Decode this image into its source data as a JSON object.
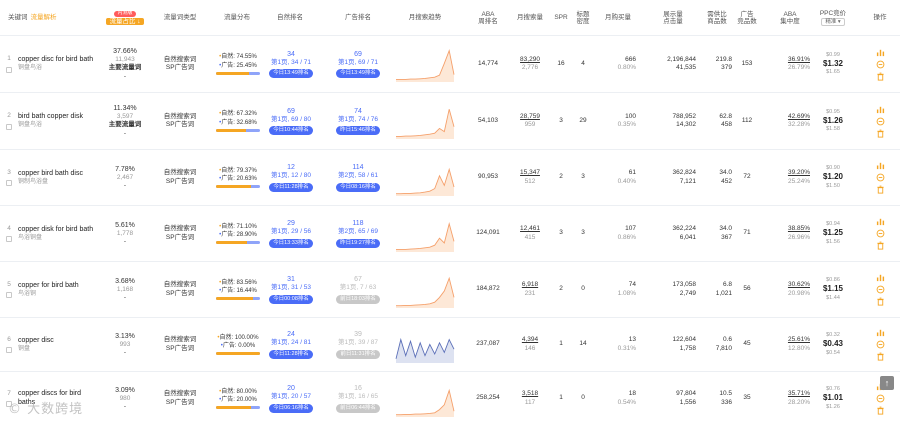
{
  "header": {
    "keyword": "关键词",
    "keyword_link": "流量解析",
    "ratio_badge": "内测版",
    "ratio": "流量占比 ↓",
    "type": "流量词类型",
    "dist": "流量分布",
    "organic_rank": "自然排名",
    "ad_rank": "广告排名",
    "trend": "月搜索趋势",
    "aba1": "ABA",
    "aba2": "周排名",
    "monthly": "月搜索量",
    "spr": "SPR",
    "title_density1": "标题",
    "title_density2": "密度",
    "purchase": "月购买量",
    "impr1": "展示量",
    "impr2": "点击量",
    "supply1": "需供比",
    "supply2": "商品数",
    "ad1": "广告",
    "ad2": "竞品数",
    "conc1": "ABA",
    "conc2": "集中度",
    "ppc": "PPC竞价",
    "ppc_sel": "精准 ▾",
    "ops": "操作"
  },
  "rows": [
    {
      "idx": "1",
      "kw": "copper disc for bird bath",
      "kw_cn": "铜盘鸟浴",
      "ratio": "37.66%",
      "ratio_sub": "11,943",
      "main": "主要流量词",
      "dash": "-",
      "type1": "自然搜索词",
      "type2": "SP广告词",
      "org_label": "自然:",
      "org_pct": "74.55%",
      "ad_label": "广告:",
      "ad_pct": "25.45%",
      "org_share": 0.7455,
      "or_main": "34",
      "or_sub": "第1页, 34 / 71",
      "or_pill": "今日13:49排名",
      "ad_main": "69",
      "ad_sub": "第1页, 69 / 71",
      "ad_pill": "今日13:49排名",
      "ad_grey": false,
      "trend": [
        0.05,
        0.05,
        0.05,
        0.06,
        0.06,
        0.07,
        0.08,
        0.1,
        0.12,
        0.18,
        0.55,
        0.95,
        0.2
      ],
      "aba": "14,774",
      "m1": "83,290",
      "m2": "2,776",
      "spr": "16",
      "td": "4",
      "p1": "666",
      "p2": "0.80%",
      "i1": "2,196,844",
      "i2": "41,535",
      "s1": "219.8",
      "s2": "379",
      "adc": "153",
      "c1": "36.91%",
      "c2": "26.79%",
      "pp1": "$0.99",
      "pp2": "$1.32",
      "pp3": "$1.65"
    },
    {
      "idx": "2",
      "kw": "bird bath copper disk",
      "kw_cn": "铜盘鸟浴",
      "ratio": "11.34%",
      "ratio_sub": "3,597",
      "main": "主要流量词",
      "dash": "-",
      "type1": "自然搜索词",
      "type2": "SP广告词",
      "org_label": "自然:",
      "org_pct": "67.32%",
      "ad_label": "广告:",
      "ad_pct": "32.68%",
      "org_share": 0.6732,
      "or_main": "69",
      "or_sub": "第1页, 69 / 80",
      "or_pill": "今日10:44排名",
      "ad_main": "74",
      "ad_sub": "第1页, 74 / 76",
      "ad_pill": "昨日15:46排名",
      "ad_grey": false,
      "trend": [
        0.05,
        0.05,
        0.06,
        0.06,
        0.07,
        0.08,
        0.1,
        0.12,
        0.15,
        0.3,
        0.2,
        0.9,
        0.35
      ],
      "aba": "54,103",
      "m1": "28,759",
      "m2": "959",
      "spr": "3",
      "td": "29",
      "p1": "100",
      "p2": "0.35%",
      "i1": "788,952",
      "i2": "14,302",
      "s1": "62.8",
      "s2": "458",
      "adc": "112",
      "c1": "42.69%",
      "c2": "32.28%",
      "pp1": "$0.95",
      "pp2": "$1.26",
      "pp3": "$1.58"
    },
    {
      "idx": "3",
      "kw": "copper bird bath disc",
      "kw_cn": "铜制鸟浴盘",
      "ratio": "7.78%",
      "ratio_sub": "2,467",
      "main": "",
      "dash": "-",
      "type1": "自然搜索词",
      "type2": "SP广告词",
      "org_label": "自然:",
      "org_pct": "79.37%",
      "ad_label": "广告:",
      "ad_pct": "20.63%",
      "org_share": 0.7937,
      "or_main": "12",
      "or_sub": "第1页, 12 / 80",
      "or_pill": "今日11:28排名",
      "ad_main": "114",
      "ad_sub": "第2页, 58 / 61",
      "ad_pill": "今日08:16排名",
      "ad_grey": false,
      "trend": [
        0.04,
        0.04,
        0.05,
        0.05,
        0.06,
        0.07,
        0.09,
        0.12,
        0.2,
        0.6,
        0.3,
        0.8,
        0.25
      ],
      "aba": "90,953",
      "m1": "15,347",
      "m2": "512",
      "spr": "2",
      "td": "3",
      "p1": "61",
      "p2": "0.40%",
      "i1": "362,824",
      "i2": "7,121",
      "s1": "34.0",
      "s2": "452",
      "adc": "72",
      "c1": "39.20%",
      "c2": "25.24%",
      "pp1": "$0.90",
      "pp2": "$1.20",
      "pp3": "$1.50"
    },
    {
      "idx": "4",
      "kw": "copper disk for bird bath",
      "kw_cn": "鸟浴铜盘",
      "ratio": "5.61%",
      "ratio_sub": "1,778",
      "main": "",
      "dash": "-",
      "type1": "自然搜索词",
      "type2": "SP广告词",
      "org_label": "自然:",
      "org_pct": "71.10%",
      "ad_label": "广告:",
      "ad_pct": "28.90%",
      "org_share": 0.711,
      "or_main": "29",
      "or_sub": "第1页, 29 / 56",
      "or_pill": "今日13:33排名",
      "ad_main": "118",
      "ad_sub": "第2页, 65 / 69",
      "ad_pill": "昨日19:27排名",
      "ad_grey": false,
      "trend": [
        0.05,
        0.05,
        0.05,
        0.06,
        0.07,
        0.08,
        0.1,
        0.12,
        0.18,
        0.4,
        0.25,
        0.85,
        0.3
      ],
      "aba": "124,091",
      "m1": "12,461",
      "m2": "415",
      "spr": "3",
      "td": "3",
      "p1": "107",
      "p2": "0.86%",
      "i1": "362,224",
      "i2": "6,041",
      "s1": "34.0",
      "s2": "367",
      "adc": "71",
      "c1": "38.85%",
      "c2": "26.96%",
      "pp1": "$0.94",
      "pp2": "$1.25",
      "pp3": "$1.56"
    },
    {
      "idx": "5",
      "kw": "copper for bird bath",
      "kw_cn": "鸟浴铜",
      "ratio": "3.68%",
      "ratio_sub": "1,168",
      "main": "",
      "dash": "-",
      "type1": "自然搜索词",
      "type2": "SP广告词",
      "org_label": "自然:",
      "org_pct": "83.56%",
      "ad_label": "广告:",
      "ad_pct": "16.44%",
      "org_share": 0.8356,
      "or_main": "31",
      "or_sub": "第1页, 31 / 53",
      "or_pill": "今日00:08排名",
      "ad_main": "67",
      "ad_sub": "第1页, 7 / 63",
      "ad_pill": "前日18:03排名",
      "ad_grey": true,
      "trend": [
        0.04,
        0.04,
        0.05,
        0.05,
        0.06,
        0.07,
        0.08,
        0.1,
        0.15,
        0.3,
        0.5,
        0.9,
        0.3
      ],
      "aba": "184,872",
      "m1": "6,918",
      "m2": "231",
      "spr": "2",
      "td": "0",
      "p1": "74",
      "p2": "1.08%",
      "i1": "173,058",
      "i2": "2,749",
      "s1": "6.8",
      "s2": "1,021",
      "adc": "56",
      "c1": "30.62%",
      "c2": "20.98%",
      "pp1": "$0.86",
      "pp2": "$1.15",
      "pp3": "$1.44"
    },
    {
      "idx": "6",
      "kw": "copper disc",
      "kw_cn": "铜盘",
      "ratio": "3.13%",
      "ratio_sub": "993",
      "main": "",
      "dash": "-",
      "type1": "自然搜索词",
      "type2": "SP广告词",
      "org_label": "自然:",
      "org_pct": "100.00%",
      "ad_label": "广告:",
      "ad_pct": "0.00%",
      "org_share": 1,
      "or_main": "24",
      "or_sub": "第1页, 24 / 81",
      "or_pill": "今日11:28排名",
      "ad_main": "39",
      "ad_sub": "第1页, 39 / 87",
      "ad_pill": "前日11:31排名",
      "ad_grey": true,
      "trend": [
        0.1,
        0.7,
        0.2,
        0.65,
        0.15,
        0.6,
        0.2,
        0.55,
        0.25,
        0.6,
        0.3,
        0.7,
        0.4
      ],
      "aba": "237,087",
      "m1": "4,394",
      "m2": "146",
      "spr": "1",
      "td": "14",
      "p1": "13",
      "p2": "0.31%",
      "i1": "122,604",
      "i2": "1,758",
      "s1": "0.6",
      "s2": "7,810",
      "adc": "45",
      "c1": "25.61%",
      "c2": "12.80%",
      "pp1": "$0.32",
      "pp2": "$0.43",
      "pp3": "$0.54"
    },
    {
      "idx": "7",
      "kw": "copper discs for bird baths",
      "kw_cn": "",
      "ratio": "3.09%",
      "ratio_sub": "980",
      "main": "",
      "dash": "-",
      "type1": "自然搜索词",
      "type2": "SP广告词",
      "org_label": "自然:",
      "org_pct": "80.00%",
      "ad_label": "广告:",
      "ad_pct": "20.00%",
      "org_share": 0.8,
      "or_main": "20",
      "or_sub": "第1页, 20 / 57",
      "or_pill": "今日06:16排名",
      "ad_main": "16",
      "ad_sub": "第1页, 16 / 65",
      "ad_pill": "前日06:44排名",
      "ad_grey": true,
      "trend": [
        0.04,
        0.04,
        0.05,
        0.05,
        0.06,
        0.06,
        0.07,
        0.08,
        0.1,
        0.2,
        0.35,
        0.8,
        0.15
      ],
      "aba": "258,254",
      "m1": "3,518",
      "m2": "117",
      "spr": "1",
      "td": "0",
      "p1": "18",
      "p2": "0.54%",
      "i1": "97,804",
      "i2": "1,556",
      "s1": "10.5",
      "s2": "336",
      "adc": "35",
      "c1": "35.71%",
      "c2": "28.20%",
      "pp1": "$0.76",
      "pp2": "$1.01",
      "pp3": "$1.26"
    }
  ],
  "watermark": "© 大数跨境",
  "back_top": "↑"
}
